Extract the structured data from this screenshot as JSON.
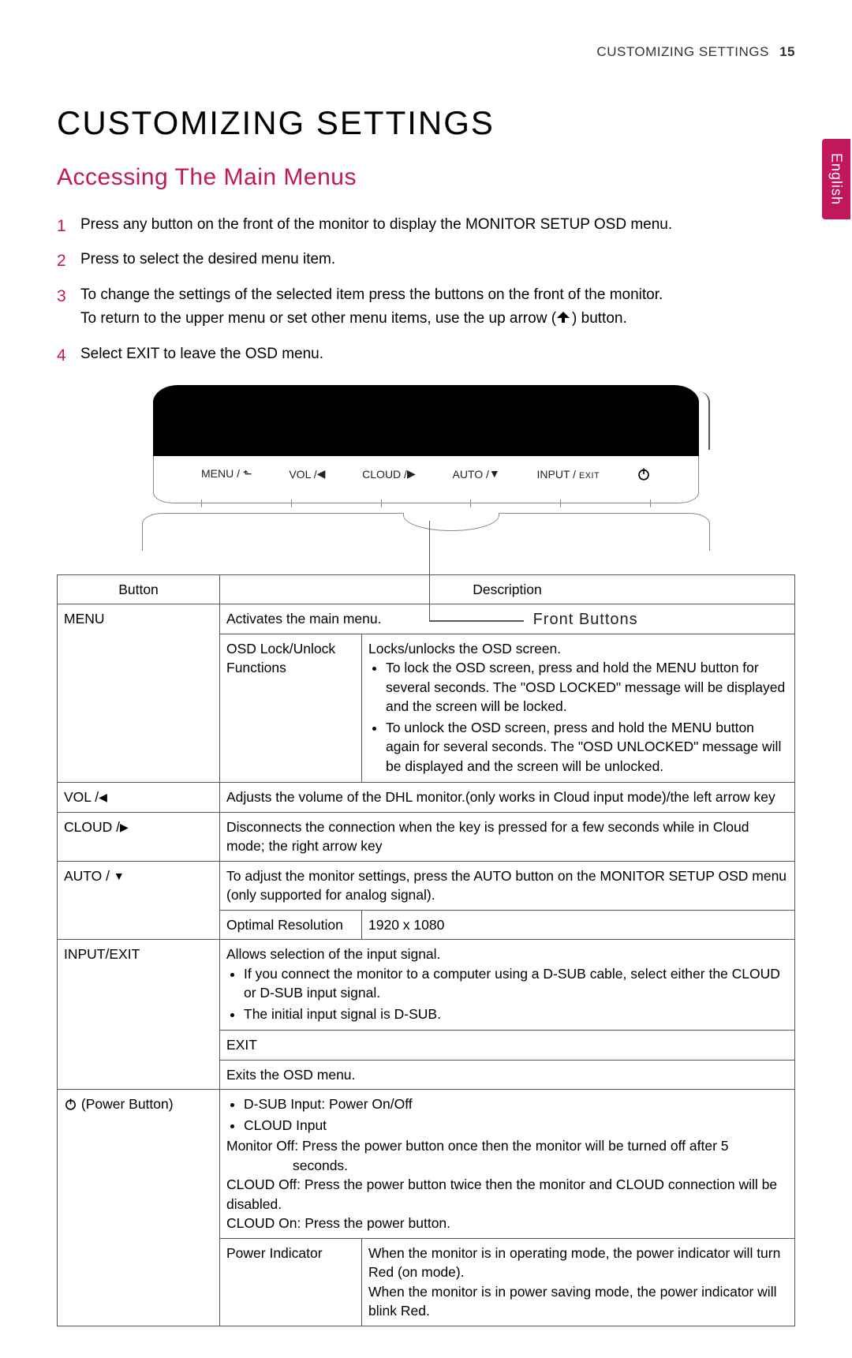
{
  "header": {
    "section": "CUSTOMIZING SETTINGS",
    "page_number": "15"
  },
  "lang_tab": "English",
  "title": "CUSTOMIZING SETTINGS",
  "section_title": "Accessing The Main Menus",
  "steps": {
    "s1": "Press any button on the front of the monitor to display the MONITOR SETUP OSD menu.",
    "s2": "Press to select the desired menu item.",
    "s3a": "To change the settings of the selected item press the buttons on the front of the monitor.",
    "s3b_pre": "To return to the upper menu or set other menu items, use the up arrow (",
    "s3b_post": ") button.",
    "s4": "Select EXIT to leave the OSD menu."
  },
  "diagram": {
    "labels": {
      "menu": "MENU /",
      "vol": "VOL /",
      "cloud": "CLOUD /",
      "auto": "AUTO /",
      "input": "INPUT /",
      "exit_small": "EXIT"
    },
    "callout": "Front  Buttons"
  },
  "table": {
    "head_button": "Button",
    "head_desc": "Description",
    "menu": {
      "name": "MENU",
      "row1": "Activates the main menu.",
      "sub_label": "OSD Lock/Unlock Functions",
      "sub_desc_intro": "Locks/unlocks the OSD screen.",
      "sub_desc_b1": "To lock the OSD screen, press and hold the MENU button for several seconds. The \"OSD LOCKED\" message will be displayed and the screen will be locked.",
      "sub_desc_b2": "To unlock the OSD screen, press and hold the MENU button again for several seconds. The \"OSD UNLOCKED\" message will be displayed and the screen will be unlocked."
    },
    "vol": {
      "name": "VOL /",
      "desc": "Adjusts the volume of the DHL monitor.(only works in Cloud input mode)/the left arrow key"
    },
    "cloud": {
      "name": "CLOUD /",
      "desc": "Disconnects the connection when the key is pressed for a few seconds while in Cloud mode; the right arrow key"
    },
    "auto": {
      "name": "AUTO / ",
      "row1": "To adjust the monitor settings, press the AUTO button on the MONITOR SETUP OSD menu (only supported for analog signal).",
      "sub_label": "Optimal Resolution",
      "sub_value": "1920 x 1080"
    },
    "input": {
      "name": "INPUT/EXIT",
      "row1_intro": "Allows selection of the input signal.",
      "row1_b1": "If you connect the monitor to a computer using a D-SUB cable, select either the CLOUD or D-SUB input signal.",
      "row1_b2": "The initial input signal is D-SUB.",
      "exit_label": "EXIT",
      "exit_desc": "Exits the OSD menu."
    },
    "power": {
      "name": " (Power Button)",
      "b1": "D-SUB Input: Power On/Off",
      "b2": "CLOUD Input",
      "line1": "Monitor Off: Press the power button once then the monitor will be turned off after 5",
      "line1b": "seconds.",
      "line2": "CLOUD Off: Press the power button twice then the monitor and CLOUD connection will be disabled.",
      "line3": "CLOUD On: Press the power button.",
      "ind_label": "Power Indicator",
      "ind_desc1": "When the monitor is in operating mode, the power indicator will turn Red (on mode).",
      "ind_desc2": "When the monitor is in power saving mode, the power indicator will blink Red."
    }
  }
}
